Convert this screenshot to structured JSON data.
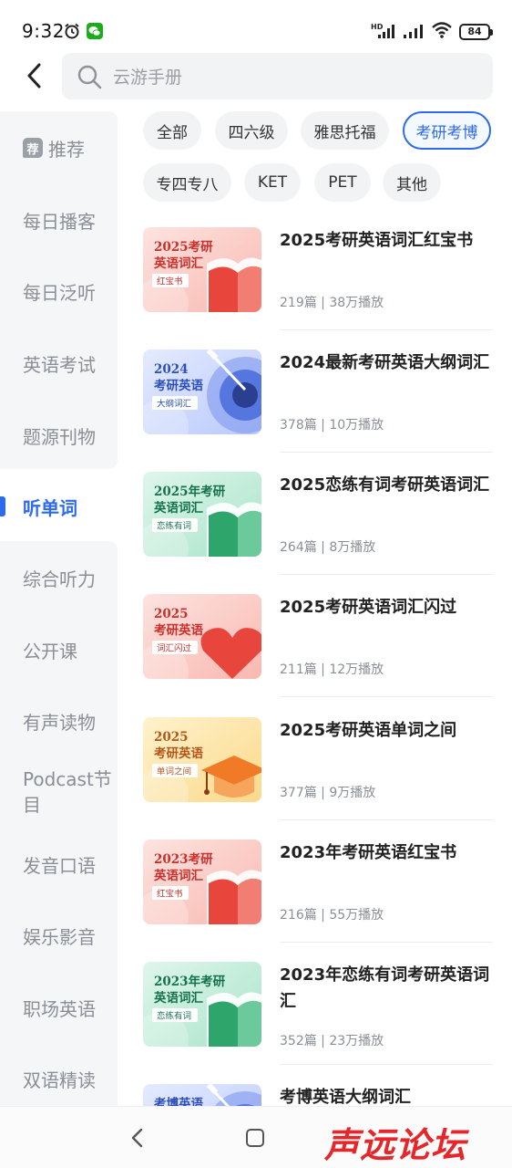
{
  "status_bar": {
    "time": "9:32",
    "battery": "84",
    "icons": [
      "alarm-icon",
      "wechat-icon",
      "hd-signal-icon",
      "signal-icon",
      "wifi-icon",
      "battery-icon"
    ]
  },
  "header": {
    "search_placeholder": "云游手册"
  },
  "sidebar": {
    "items": [
      {
        "label": "推荐",
        "badge": "荐"
      },
      {
        "label": "每日播客"
      },
      {
        "label": "每日泛听"
      },
      {
        "label": "英语考试"
      },
      {
        "label": "题源刊物"
      },
      {
        "label": "听单词"
      },
      {
        "label": "综合听力"
      },
      {
        "label": "公开课"
      },
      {
        "label": "有声读物"
      },
      {
        "label": "Podcast节目"
      },
      {
        "label": "发音口语"
      },
      {
        "label": "娱乐影音"
      },
      {
        "label": "职场英语"
      },
      {
        "label": "双语精读"
      }
    ],
    "active_index": 5
  },
  "chips": [
    {
      "label": "全部"
    },
    {
      "label": "四六级"
    },
    {
      "label": "雅思托福"
    },
    {
      "label": "考研考博",
      "selected": true
    },
    {
      "label": "专四专八"
    },
    {
      "label": "KET"
    },
    {
      "label": "PET"
    },
    {
      "label": "其他"
    }
  ],
  "list": [
    {
      "title": "2025考研英语词汇红宝书",
      "meta": "219篇 | 38万播放",
      "cover": {
        "line1": "2025考研",
        "line2": "英语词汇",
        "tag": "红宝书",
        "theme": "red",
        "art": "book"
      }
    },
    {
      "title": "2024最新考研英语大纲词汇",
      "meta": "378篇 | 10万播放",
      "cover": {
        "line1": "2024",
        "line2": "考研英语",
        "tag": "大纲词汇",
        "theme": "blue",
        "art": "target"
      }
    },
    {
      "title": "2025恋练有词考研英语词汇",
      "meta": "264篇 | 8万播放",
      "cover": {
        "line1": "2025年考研",
        "line2": "英语词汇",
        "tag": "恋练有词",
        "theme": "green",
        "art": "book"
      }
    },
    {
      "title": "2025考研英语词汇闪过",
      "meta": "211篇 | 12万播放",
      "cover": {
        "line1": "2025",
        "line2": "考研英语",
        "tag": "词汇闪过",
        "theme": "red",
        "art": "heart"
      }
    },
    {
      "title": "2025考研英语单词之间",
      "meta": "377篇 | 9万播放",
      "cover": {
        "line1": "2025",
        "line2": "考研英语",
        "tag": "单词之间",
        "theme": "yellow",
        "art": "cap"
      }
    },
    {
      "title": "2023年考研英语红宝书",
      "meta": "216篇 | 55万播放",
      "cover": {
        "line1": "2023考研",
        "line2": "英语词汇",
        "tag": "红宝书",
        "theme": "red",
        "art": "book"
      }
    },
    {
      "title": "2023年恋练有词考研英语词汇",
      "meta": "352篇 | 23万播放",
      "cover": {
        "line1": "2023年考研",
        "line2": "英语词汇",
        "tag": "恋练有词",
        "theme": "green",
        "art": "book"
      }
    },
    {
      "title": "考博英语大纲词汇",
      "meta": "",
      "cover": {
        "line1": "考博英语",
        "line2": "",
        "tag": "",
        "theme": "blue",
        "art": "target"
      }
    }
  ],
  "watermark": "声远论坛",
  "themes": {
    "red": {
      "bg1": "#fde3df",
      "bg2": "#f9b8b0",
      "text": "#c9302c",
      "art": "#e8453c",
      "art2": "#f27d72"
    },
    "blue": {
      "bg1": "#e4ebff",
      "bg2": "#b9c9fb",
      "text": "#2d4fb8",
      "art": "#3f63d8",
      "art2": "#7f98ef"
    },
    "green": {
      "bg1": "#dff6ec",
      "bg2": "#a9e4c9",
      "text": "#13724a",
      "art": "#2ea56b",
      "art2": "#6cc99b"
    },
    "yellow": {
      "bg1": "#fff2cc",
      "bg2": "#fbd98a",
      "text": "#b2561a",
      "art": "#f07a26",
      "art2": "#f7a55c"
    }
  },
  "accent": "#2d6bea"
}
